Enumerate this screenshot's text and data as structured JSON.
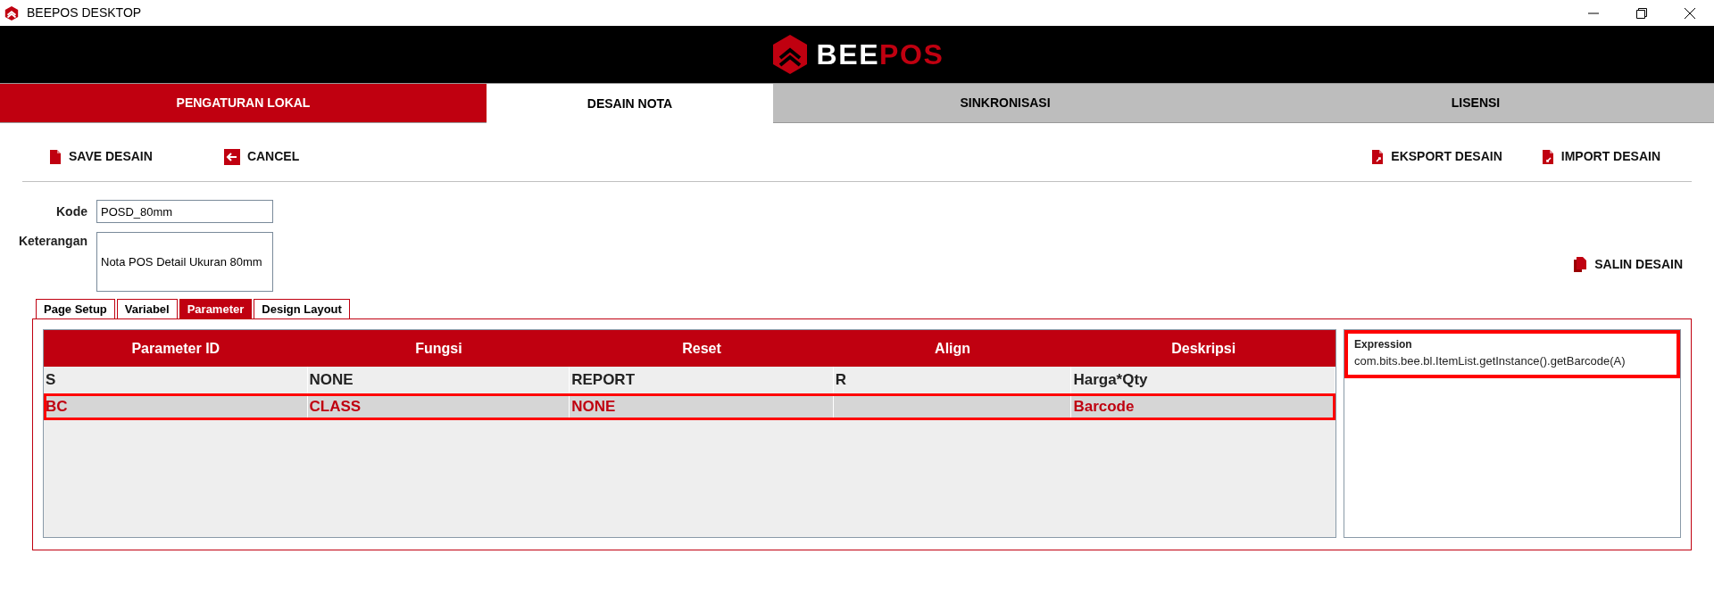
{
  "window": {
    "title": "BEEPOS DESKTOP"
  },
  "logo": {
    "part_1": "BEE",
    "part_2": "POS"
  },
  "nav_tabs": [
    {
      "label": "PENGATURAN LOKAL",
      "kind": "red",
      "selected": false
    },
    {
      "label": "DESAIN NOTA",
      "kind": "plain",
      "selected": true
    },
    {
      "label": "SINKRONISASI",
      "kind": "grey",
      "selected": false
    },
    {
      "label": "LISENSI",
      "kind": "grey",
      "selected": false
    }
  ],
  "toolbar_left": [
    {
      "label": "SAVE DESAIN",
      "kind": "file"
    },
    {
      "label": "CANCEL",
      "kind": "back"
    }
  ],
  "toolbar_right": [
    {
      "label": "EKSPORT DESAIN",
      "kind": "export"
    },
    {
      "label": "IMPORT DESAIN",
      "kind": "import"
    }
  ],
  "form": {
    "kode_label": "Kode",
    "kode_value": "POSD_80mm",
    "keterangan_label": "Keterangan",
    "keterangan_value": "Nota POS Detail Ukuran 80mm"
  },
  "copy_button": {
    "label": "SALIN DESAIN"
  },
  "sub_tabs": [
    {
      "label": "Page Setup",
      "selected": false
    },
    {
      "label": "Variabel",
      "selected": false
    },
    {
      "label": "Parameter",
      "selected": true
    },
    {
      "label": "Design Layout",
      "selected": false
    }
  ],
  "table": {
    "columns": [
      "Parameter ID",
      "Fungsi",
      "Reset",
      "Align",
      "Deskripsi"
    ],
    "rows": [
      {
        "cells": [
          "S",
          "NONE",
          "REPORT",
          "R",
          "Harga*Qty"
        ],
        "selected": false
      },
      {
        "cells": [
          "BC",
          "CLASS",
          "NONE",
          "",
          "Barcode"
        ],
        "selected": true
      }
    ]
  },
  "expression": {
    "label": "Expression",
    "value": "com.bits.bee.bl.ItemList.getInstance().getBarcode(A)",
    "focused": true
  }
}
